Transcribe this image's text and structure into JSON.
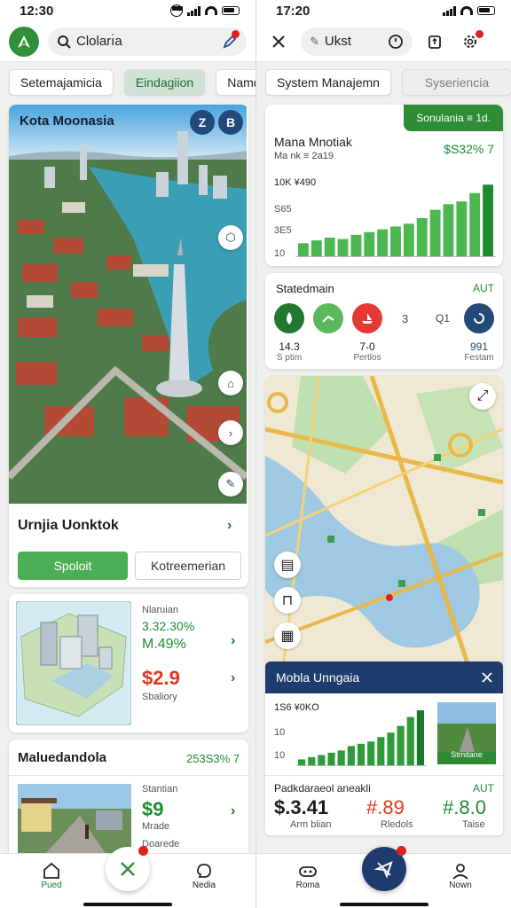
{
  "left": {
    "status": {
      "time": "12:30"
    },
    "header": {
      "search_text": "Cloları̇a"
    },
    "chips": [
      "Setemajamicia",
      "Eindagiion",
      "Namd"
    ],
    "hero": {
      "title": "Kota Moonasia",
      "badge_a": "Z",
      "badge_b": "B",
      "row_title": "Urnjia Uonktok",
      "btn_primary": "Spoloit",
      "btn_secondary": "Kotreemerian"
    },
    "stats_card": {
      "label": "Nlaruian",
      "value1": "3.32.30%",
      "value2": "M.49%",
      "price": "$2.9",
      "price_label": "Sbaliory"
    },
    "list_card": {
      "title": "Maluedandola",
      "value": "253S3% 7",
      "label1": "Stantian",
      "price": "$9",
      "label2": "Mrade",
      "label3": "Doarede"
    },
    "nav": {
      "home_label": "Pued",
      "fab_icon": "close-icon",
      "right_label": "Nedia"
    }
  },
  "right": {
    "status": {
      "time": "17:20"
    },
    "header": {
      "search_text": "Ukst"
    },
    "chips": [
      "System Manajemn",
      "Syseriencia"
    ],
    "chart_card": {
      "badge": "Sonulania  ≡ 1d.",
      "title": "Mana Mnotiak",
      "subtitle": "Ma nk ≡ 2a19",
      "value": "$S32% 7",
      "y_labels": [
        "10K ¥490",
        "S65",
        "3E5",
        "10"
      ]
    },
    "stated_card": {
      "title": "Statedmain",
      "tag": "AUT",
      "stats": [
        {
          "value": "14.3",
          "label": "S ptim"
        },
        {
          "value": "7-0",
          "label": "Pertlos"
        },
        {
          "value": "991",
          "label": "Festam"
        }
      ],
      "mid_a": "3",
      "mid_b": "Q1"
    },
    "popup": {
      "title": "Mobla Unngaia",
      "y_top": "1S6 ¥0KO",
      "y_mid": "10",
      "y_bot": "10",
      "thumb_label": "Stmitane"
    },
    "bottom_card": {
      "title": "Padkdaraeol aneakli",
      "tag": "AUT",
      "v1": "$.3.41",
      "l1": "Arm blian",
      "v2": "#.89",
      "l2": "Rledols",
      "v3": "#.8.0",
      "l3": "Taise"
    },
    "nav": {
      "left_label": "Roma",
      "right_label": "Nown"
    }
  },
  "chart_data": [
    {
      "type": "bar",
      "categories": [
        "1",
        "2",
        "3",
        "4",
        "5",
        "6",
        "7",
        "8",
        "9",
        "10",
        "11",
        "12",
        "13",
        "14",
        "15"
      ],
      "values": [
        10,
        12,
        14,
        13,
        16,
        18,
        20,
        22,
        24,
        28,
        34,
        38,
        40,
        46,
        52
      ],
      "title": "Mana Mnotiak",
      "ylim": [
        0,
        56
      ]
    },
    {
      "type": "bar",
      "categories": [
        "1",
        "2",
        "3",
        "4",
        "5",
        "6",
        "7",
        "8",
        "9",
        "10",
        "11",
        "12",
        "13"
      ],
      "values": [
        6,
        8,
        10,
        12,
        14,
        18,
        20,
        22,
        26,
        30,
        36,
        44,
        50
      ],
      "title": "Mobla Unngaia",
      "ylim": [
        0,
        54
      ]
    }
  ]
}
